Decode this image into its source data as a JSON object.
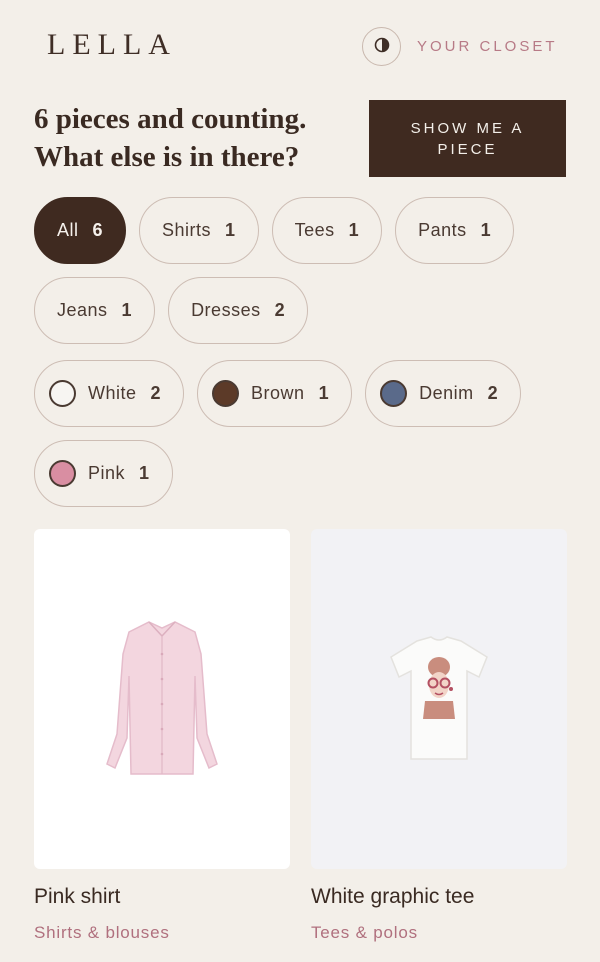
{
  "header": {
    "logo": "LELLA",
    "closet_link": "YOUR CLOSET",
    "theme_icon": "half-circle-contrast-icon"
  },
  "hero": {
    "headline": "6 pieces and counting. What else is in there?",
    "cta": "SHOW ME A PIECE"
  },
  "categories": [
    {
      "label": "All",
      "count": "6",
      "active": true
    },
    {
      "label": "Shirts",
      "count": "1"
    },
    {
      "label": "Tees",
      "count": "1"
    },
    {
      "label": "Pants",
      "count": "1"
    },
    {
      "label": "Jeans",
      "count": "1"
    },
    {
      "label": "Dresses",
      "count": "2"
    }
  ],
  "colors": [
    {
      "label": "White",
      "count": "2",
      "swatch": "#f7f5f2"
    },
    {
      "label": "Brown",
      "count": "1",
      "swatch": "#5c3a28"
    },
    {
      "label": "Denim",
      "count": "2",
      "swatch": "#5a6a8a"
    },
    {
      "label": "Pink",
      "count": "1",
      "swatch": "#d98ea2"
    }
  ],
  "products": [
    {
      "name": "Pink shirt",
      "category": "Shirts & blouses",
      "bg": "#ffffff",
      "icon": "pink-shirt-icon"
    },
    {
      "name": "White graphic tee",
      "category": "Tees & polos",
      "bg": "#f2f2f5",
      "icon": "graphic-tee-icon"
    }
  ],
  "palette": {
    "background": "#f3efe9",
    "primary": "#3f2a20",
    "accent": "#b77a86"
  }
}
